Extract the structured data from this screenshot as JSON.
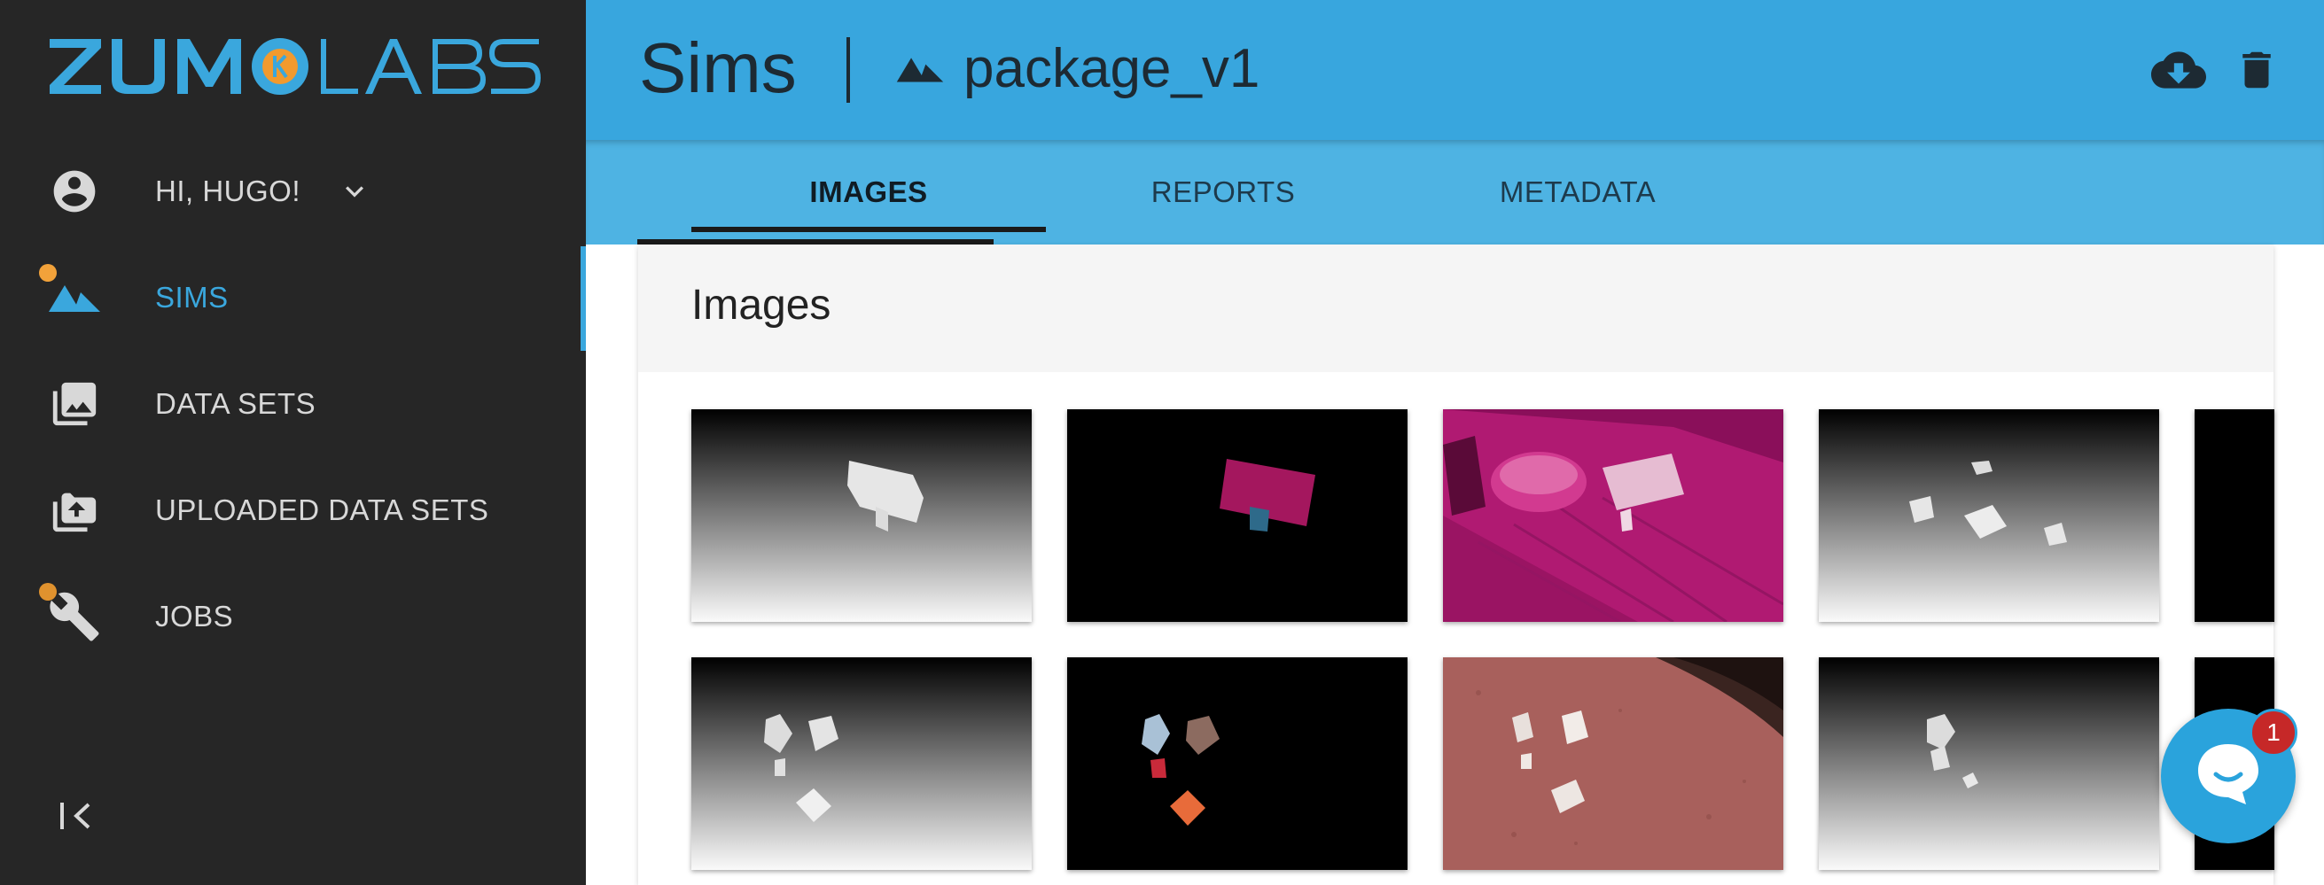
{
  "brand": {
    "logo_text_left": "ZUM",
    "logo_text_right": "LABS",
    "logo_color": "#3aa7dd",
    "logo_accent": "#f29a2e"
  },
  "user": {
    "greeting": "HI, HUGO!",
    "icon": "account-circle-icon"
  },
  "sidebar": {
    "items": [
      {
        "label": "SIMS",
        "icon": "terrain-icon",
        "active": true,
        "dot_color": "#f2a23a"
      },
      {
        "label": "DATA SETS",
        "icon": "photo-library-icon",
        "active": false
      },
      {
        "label": "UPLOADED DATA SETS",
        "icon": "upload-folder-icon",
        "active": false
      },
      {
        "label": "JOBS",
        "icon": "wrench-icon",
        "active": false,
        "dot_color": "#e0922e"
      }
    ],
    "collapse_icon": "collapse-left-icon"
  },
  "header": {
    "title": "Sims",
    "separator": "|",
    "package_name": "package_v1",
    "package_icon": "terrain-icon",
    "actions": [
      "cloud-download-icon",
      "trash-icon"
    ],
    "bg_color": "#38a6de"
  },
  "tabs": [
    {
      "label": "IMAGES",
      "active": true
    },
    {
      "label": "REPORTS",
      "active": false
    },
    {
      "label": "METADATA",
      "active": false
    }
  ],
  "images_section": {
    "title": "Images",
    "thumbnails": [
      {
        "kind": "depth-single-box"
      },
      {
        "kind": "segmentation-magenta-box"
      },
      {
        "kind": "rgb-magenta-scene"
      },
      {
        "kind": "depth-scattered-boxes"
      },
      {
        "kind": "black-partial"
      },
      {
        "kind": "depth-multi-boxes"
      },
      {
        "kind": "segmentation-multi-color"
      },
      {
        "kind": "rgb-red-dirt-scene"
      },
      {
        "kind": "depth-cluster"
      },
      {
        "kind": "black-partial"
      }
    ]
  },
  "chat": {
    "badge_count": "1",
    "icon": "chat-bubble-icon"
  }
}
